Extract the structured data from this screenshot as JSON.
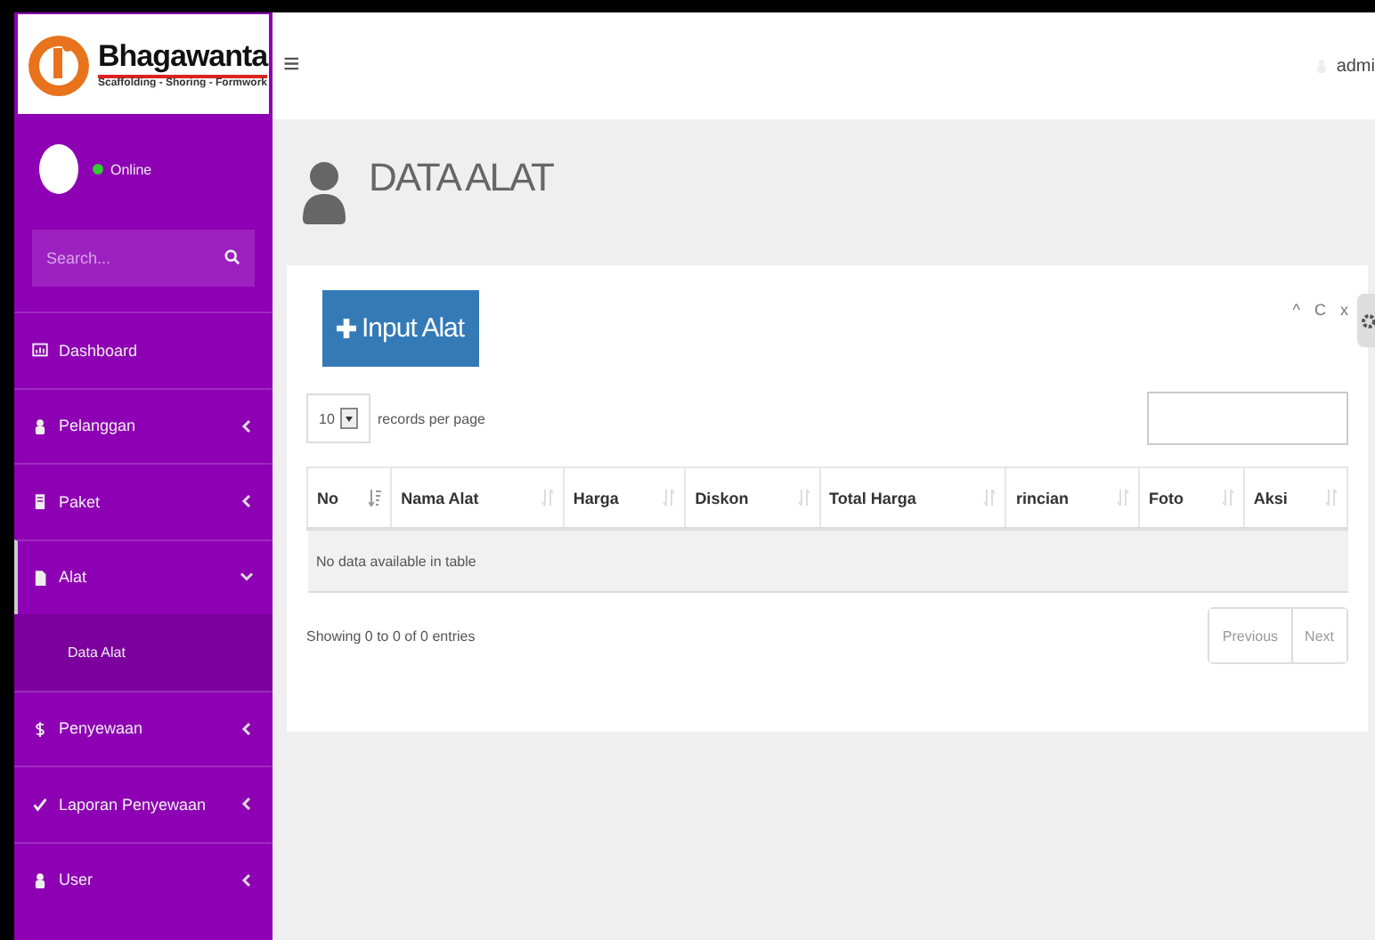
{
  "brand": {
    "name": "Bhagawanta",
    "tagline": "Scaffolding - Shoring - Formwork"
  },
  "user_panel": {
    "status": "Online",
    "online": true
  },
  "sidebar": {
    "search_placeholder": "Search...",
    "items": [
      {
        "label": "Dashboard"
      },
      {
        "label": "Pelanggan",
        "expanded": false
      },
      {
        "label": "Paket",
        "expanded": false
      },
      {
        "label": "Alat",
        "expanded": true,
        "children": [
          {
            "label": "Data Alat",
            "selected": true
          }
        ]
      },
      {
        "label": "Penyewaan",
        "expanded": false
      },
      {
        "label": "Laporan Penyewaan",
        "expanded": false
      },
      {
        "label": "User",
        "expanded": false
      }
    ]
  },
  "header": {
    "menu_icon": "≡",
    "user": "admi"
  },
  "page": {
    "title": "DATA ALAT"
  },
  "card": {
    "add_button": "Input Alat",
    "tools": [
      "^",
      "C",
      "x"
    ],
    "page_size": "10",
    "page_size_label": "records per page",
    "columns": [
      {
        "label": "No",
        "sorted": true
      },
      {
        "label": "Nama Alat",
        "sorted": false
      },
      {
        "label": "Harga",
        "sorted": false
      },
      {
        "label": "Diskon",
        "sorted": false
      },
      {
        "label": "Total Harga",
        "sorted": false
      },
      {
        "label": "rincian",
        "sorted": false
      },
      {
        "label": "Foto",
        "sorted": false
      },
      {
        "label": "Aksi",
        "sorted": false
      }
    ],
    "empty": "No data available in table",
    "info": "Showing 0 to 0 of 0 entries",
    "pager": [
      {
        "label": "Previous",
        "disabled": true
      },
      {
        "label": "Next",
        "disabled": true
      }
    ]
  }
}
